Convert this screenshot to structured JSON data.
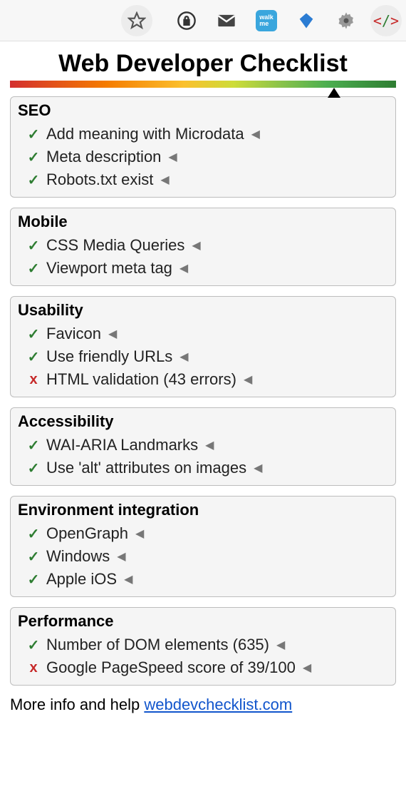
{
  "title": "Web Developer Checklist",
  "score_marker_percent": 84,
  "sections": [
    {
      "title": "SEO",
      "items": [
        {
          "status": "pass",
          "label": "Add meaning with Microdata"
        },
        {
          "status": "pass",
          "label": "Meta description"
        },
        {
          "status": "pass",
          "label": "Robots.txt exist"
        }
      ]
    },
    {
      "title": "Mobile",
      "items": [
        {
          "status": "pass",
          "label": "CSS Media Queries"
        },
        {
          "status": "pass",
          "label": "Viewport meta tag"
        }
      ]
    },
    {
      "title": "Usability",
      "items": [
        {
          "status": "pass",
          "label": "Favicon"
        },
        {
          "status": "pass",
          "label": "Use friendly URLs"
        },
        {
          "status": "fail",
          "label": "HTML validation (43 errors)"
        }
      ]
    },
    {
      "title": "Accessibility",
      "items": [
        {
          "status": "pass",
          "label": "WAI-ARIA Landmarks"
        },
        {
          "status": "pass",
          "label": "Use 'alt' attributes on images"
        }
      ]
    },
    {
      "title": "Environment integration",
      "items": [
        {
          "status": "pass",
          "label": "OpenGraph"
        },
        {
          "status": "pass",
          "label": "Windows"
        },
        {
          "status": "pass",
          "label": "Apple iOS"
        }
      ]
    },
    {
      "title": "Performance",
      "items": [
        {
          "status": "pass",
          "label": "Number of DOM elements (635)"
        },
        {
          "status": "fail",
          "label": "Google PageSpeed score of 39/100"
        }
      ]
    }
  ],
  "footer": {
    "prefix": "More info and help ",
    "link_text": "webdevchecklist.com"
  },
  "glyphs": {
    "pass": "✓",
    "fail": "x",
    "expand": "◀"
  }
}
